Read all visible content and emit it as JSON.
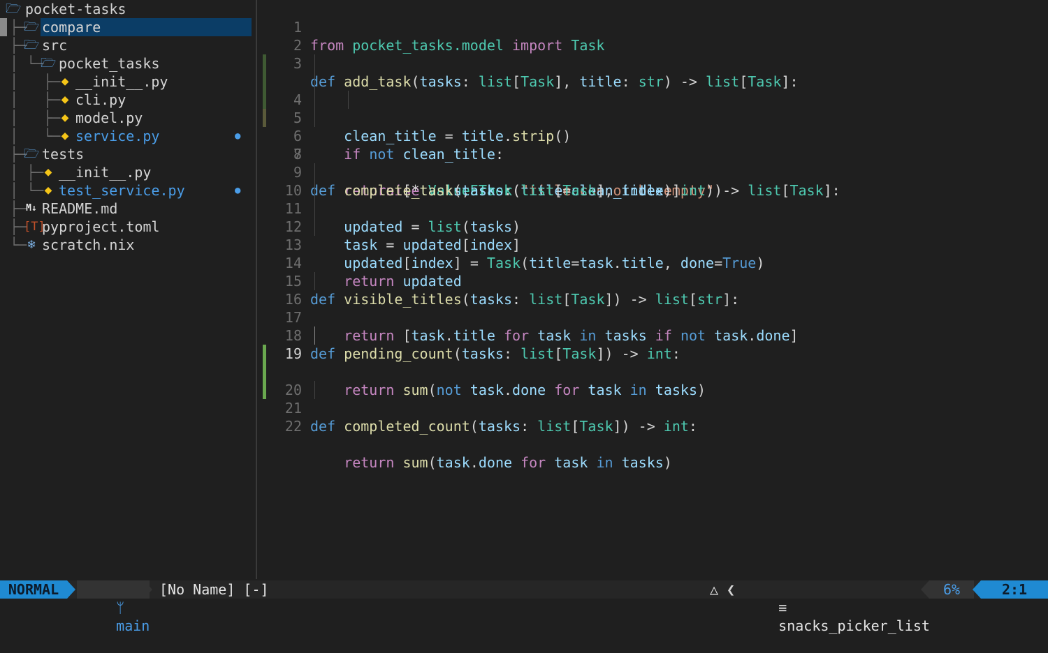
{
  "explorer": {
    "items": [
      {
        "label": "pocket-tasks",
        "type": "folder",
        "modified": false
      },
      {
        "label": "compare",
        "type": "folder",
        "modified": false
      },
      {
        "label": "src",
        "type": "folder",
        "modified": false
      },
      {
        "label": "pocket_tasks",
        "type": "folder",
        "modified": false
      },
      {
        "label": "__init__.py",
        "type": "python",
        "modified": false
      },
      {
        "label": "cli.py",
        "type": "python",
        "modified": false
      },
      {
        "label": "model.py",
        "type": "python",
        "modified": false
      },
      {
        "label": "service.py",
        "type": "python",
        "modified": true
      },
      {
        "label": "tests",
        "type": "folder",
        "modified": false
      },
      {
        "label": "__init__.py",
        "type": "python",
        "modified": false
      },
      {
        "label": "test_service.py",
        "type": "python",
        "modified": true
      },
      {
        "label": "README.md",
        "type": "markdown",
        "modified": false
      },
      {
        "label": "pyproject.toml",
        "type": "toml",
        "modified": false
      },
      {
        "label": "scratch.nix",
        "type": "nix",
        "modified": false
      }
    ],
    "modified_dot": "●",
    "icons": {
      "folder": "folder-open-icon",
      "python": "python-icon",
      "markdown": "markdown-icon",
      "toml": "toml-icon",
      "nix": "nix-icon"
    }
  },
  "editor": {
    "current_line": 19,
    "line_numbers": [
      "1",
      "2",
      "3",
      "4",
      "5",
      "6",
      "7",
      "8",
      "9",
      "10",
      "11",
      "12",
      "13",
      "14",
      "15",
      "16",
      "17",
      "18",
      "19",
      "20",
      "21",
      "22"
    ]
  },
  "colors": {
    "accent": "#1f8ad2",
    "modified": "#4a9de8",
    "git_changed": "#4a6a3a",
    "git_added": "#6aa84f"
  },
  "statusline": {
    "mode": "NORMAL",
    "branch_icon": "git-branch-icon",
    "branch": "main",
    "buffer": "[No Name] [-]",
    "filetype_icon": "linux-icon",
    "filetype_sep": "❮",
    "filetype": "snacks_picker_list",
    "percent": "6%",
    "position": "2:1"
  }
}
